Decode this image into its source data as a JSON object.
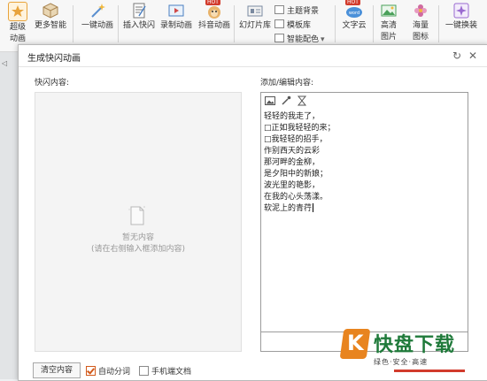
{
  "ribbon": {
    "buttons": [
      {
        "label": "超级",
        "label2": "动画",
        "icon": "star-icon",
        "color": "#e8a33b"
      },
      {
        "label": "更多智能",
        "label2": "",
        "icon": "cube-icon",
        "color": "#c8a26a"
      },
      {
        "label": "一键动画",
        "label2": "",
        "icon": "magic-wand-icon",
        "color": "#5a8fd0"
      },
      {
        "label": "插入快闪",
        "label2": "",
        "icon": "document-icon",
        "color": "#8a8a8a"
      },
      {
        "label": "录制动画",
        "label2": "",
        "icon": "video-icon",
        "color": "#d04a4a"
      },
      {
        "label": "抖音动画",
        "label2": "",
        "icon": "monkey-icon",
        "color": "#e8a33b",
        "badge": "HOT"
      },
      {
        "label": "幻灯片库",
        "label2": "",
        "icon": "slides-icon",
        "color": "#7a8aa0"
      },
      {
        "label": "文字云",
        "label2": "",
        "icon": "word-cloud-icon",
        "color": "#4a90d9",
        "badge": "HOT"
      },
      {
        "label": "高清",
        "label2": "图片",
        "icon": "image-icon",
        "color": "#4aa05a"
      },
      {
        "label": "海量",
        "label2": "图标",
        "icon": "flower-icon",
        "color": "#d06aa0"
      },
      {
        "label": "一键换装",
        "label2": "",
        "icon": "sparkle-icon",
        "color": "#9a6ad0"
      }
    ],
    "mini_items": [
      "主题背景",
      "模板库",
      "智能配色"
    ]
  },
  "dialog": {
    "title": "生成快闪动画",
    "left_label": "快闪内容:",
    "right_label": "添加/编辑内容:",
    "empty_title": "暂无内容",
    "empty_hint": "(请在右侧输入框添加内容)",
    "lines": [
      "轻轻的我走了，",
      "□正如我轻轻的来；",
      "□我轻轻的招手，",
      "作别西天的云彩",
      " 那河畔的金柳，",
      "是夕阳中的新娘；",
      "波光里的艳影，",
      "在我的心头荡漾。",
      "软泥上的青荇"
    ],
    "clear_button": "清空内容",
    "auto_split": {
      "label": "自动分词",
      "checked": true
    },
    "mobile_doc": {
      "label": "手机端文档",
      "checked": false
    }
  },
  "watermark": {
    "mark": "K",
    "text": "快盘下载",
    "slogan": "绿色·安全·高速"
  },
  "colors": {
    "accent": "#d25a1b",
    "brand_green": "#1f7a3a",
    "brand_orange": "#e8841f"
  }
}
